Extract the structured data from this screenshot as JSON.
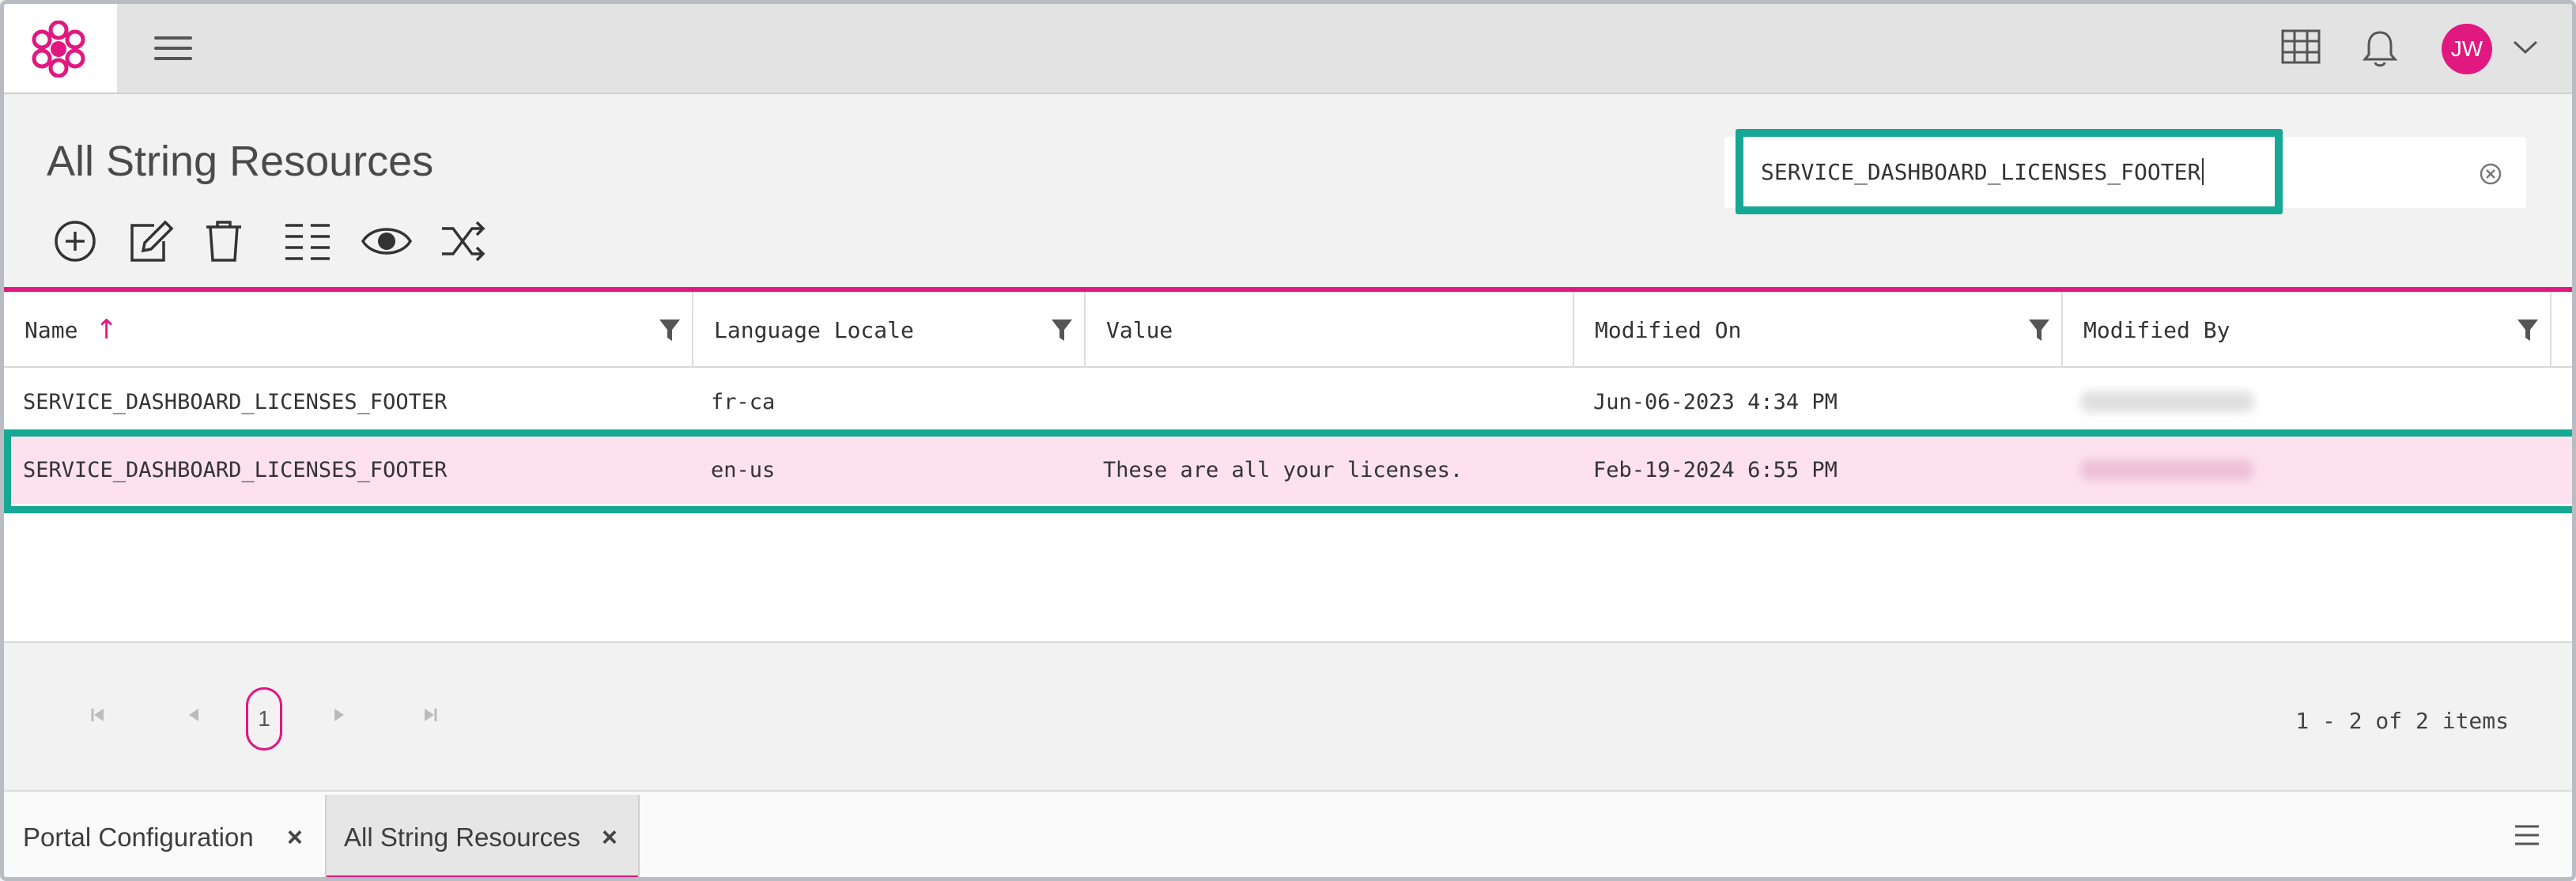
{
  "app": {
    "logo_icon": "flower-logo-icon",
    "menu_icon": "hamburger-menu-icon",
    "grid_icon": "apps-grid-icon",
    "bell_icon": "notification-bell-icon",
    "user_initials": "JW",
    "chevron_icon": "chevron-down-icon"
  },
  "page": {
    "title": "All String Resources"
  },
  "search": {
    "value": "SERVICE_DASHBOARD_LICENSES_FOOTER",
    "clear_icon": "clear-circle-icon"
  },
  "toolbar": {
    "tools": [
      "add-circle-icon",
      "edit-icon",
      "delete-trash-icon",
      "columns-list-icon",
      "view-eye-icon",
      "shuffle-icon"
    ]
  },
  "table": {
    "columns": [
      "Name",
      "Language Locale",
      "Value",
      "Modified On",
      "Modified By"
    ],
    "sort_indicator": "↑",
    "rows": [
      {
        "name": "SERVICE_DASHBOARD_LICENSES_FOOTER",
        "locale": "fr-ca",
        "value": "",
        "modified_on": "Jun-06-2023 4:34 PM",
        "selected": false
      },
      {
        "name": "SERVICE_DASHBOARD_LICENSES_FOOTER",
        "locale": "en-us",
        "value": "These are all your licenses.",
        "modified_on": "Feb-19-2024 6:55 PM",
        "selected": true
      }
    ]
  },
  "pager": {
    "current_page": "1",
    "info": "1 - 2 of 2 items"
  },
  "tabs": [
    {
      "label": "Portal Configuration",
      "close": "×",
      "active": false
    },
    {
      "label": "All String Resources",
      "close": "×",
      "active": true
    }
  ],
  "colors": {
    "accent": "#e0187f",
    "highlight": "#16a894",
    "selected_row": "#fde1ef"
  }
}
